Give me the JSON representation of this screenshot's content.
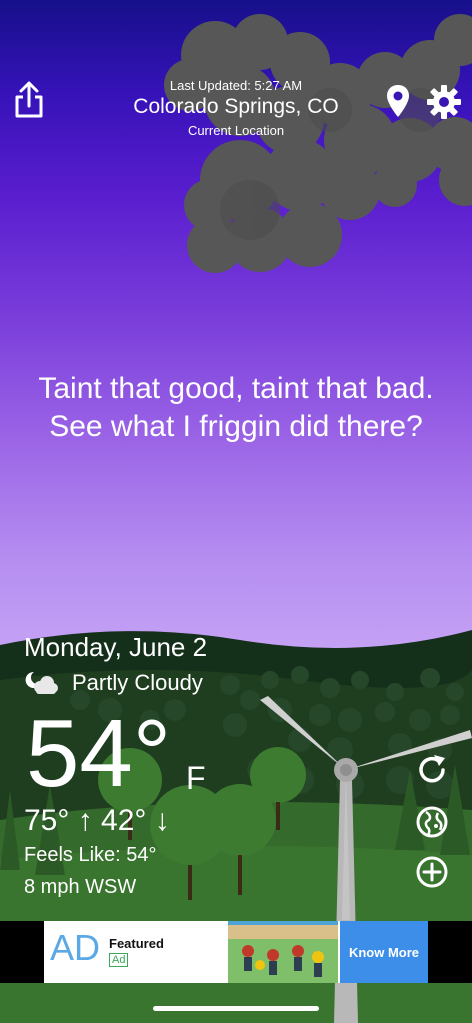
{
  "header": {
    "last_updated": "Last Updated: 5:27 AM",
    "city": "Colorado Springs, CO",
    "location_label": "Current Location"
  },
  "quote": "Taint that good, taint that bad. See what I friggin did there?",
  "weather": {
    "date": "Monday, June 2",
    "condition": "Partly Cloudy",
    "condition_icon": "partly-cloudy-night-icon",
    "temperature": "54°",
    "unit": "F",
    "high_low": "75° ↑  42° ↓",
    "feels_like": "Feels Like: 54°",
    "wind": "8 mph WSW"
  },
  "side_actions": [
    "refresh-icon",
    "globe-icon",
    "add-icon"
  ],
  "ad": {
    "logo": "AD",
    "title": "Featured",
    "badge": "Ad",
    "cta": "Know More"
  },
  "colors": {
    "sky_top": "#16108a",
    "sky_bottom": "#c6a4f5",
    "ad_cta": "#3d8ee8",
    "ground": "#2f5a2a"
  }
}
